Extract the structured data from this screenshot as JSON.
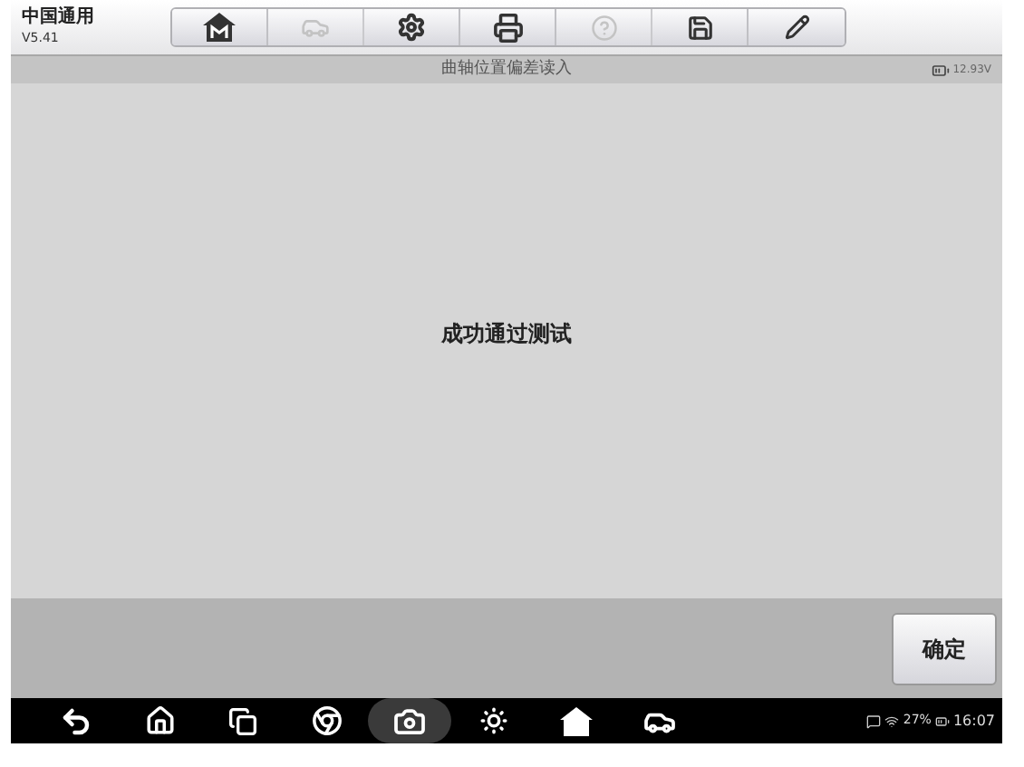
{
  "app": {
    "title": "中国通用",
    "version": "V5.41"
  },
  "toolbar": [
    {
      "kind": "home",
      "disabled": false
    },
    {
      "kind": "vehicle",
      "disabled": true
    },
    {
      "kind": "settings",
      "disabled": false
    },
    {
      "kind": "print",
      "disabled": false
    },
    {
      "kind": "help",
      "disabled": true
    },
    {
      "kind": "save",
      "disabled": false
    },
    {
      "kind": "edit",
      "disabled": false
    }
  ],
  "title_bar": {
    "title": "曲轴位置偏差读入",
    "voltage": "12.93V"
  },
  "message": "成功通过测试",
  "footer": {
    "buttons": [
      "确定"
    ]
  },
  "nav_bar": {
    "items": [
      {
        "kind": "back",
        "selected": false
      },
      {
        "kind": "home",
        "selected": false
      },
      {
        "kind": "recents",
        "selected": false
      },
      {
        "kind": "browser",
        "selected": false
      },
      {
        "kind": "camera",
        "selected": true
      },
      {
        "kind": "display",
        "selected": false
      },
      {
        "kind": "app",
        "selected": false
      },
      {
        "kind": "car",
        "selected": false
      }
    ],
    "battery": "27%",
    "time": "16:07"
  }
}
